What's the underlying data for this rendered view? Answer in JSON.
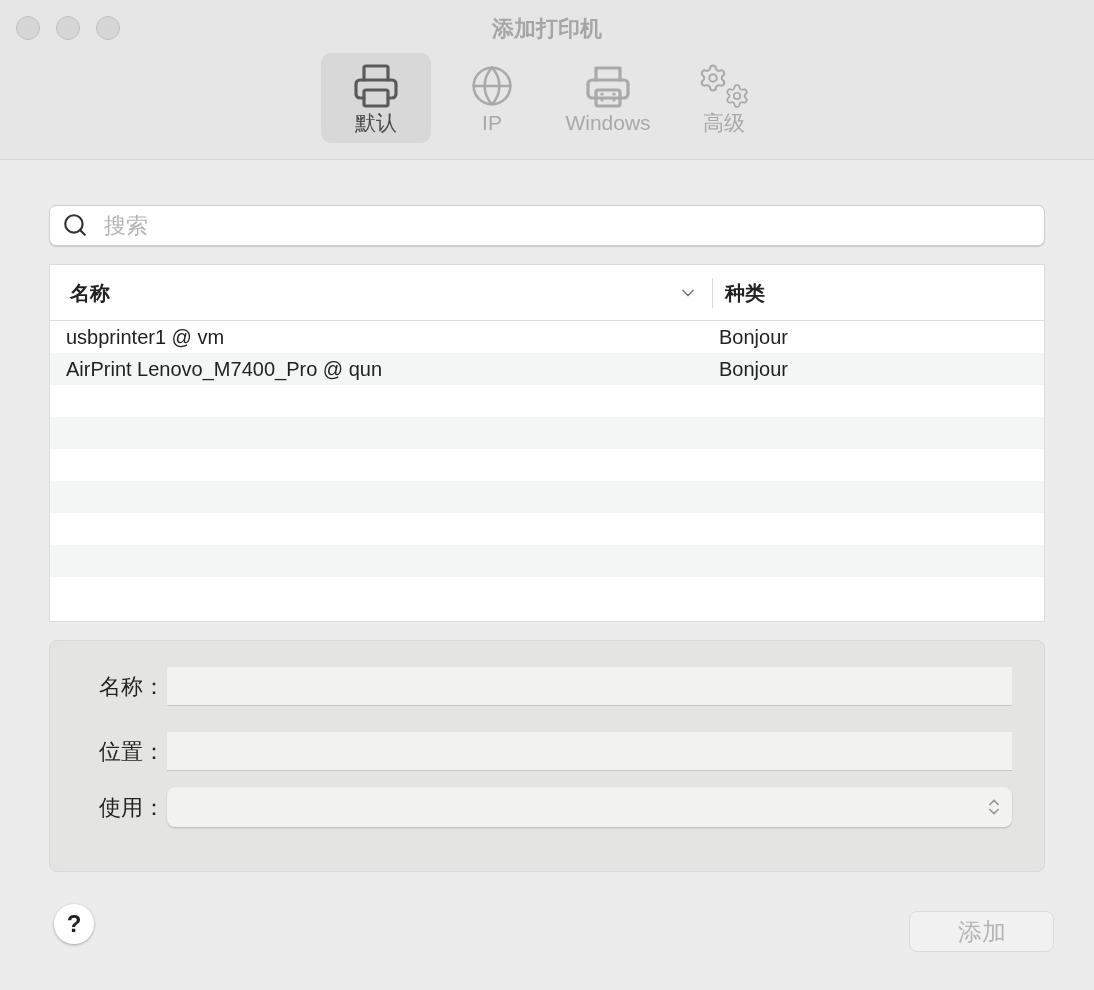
{
  "window": {
    "title": "添加打印机"
  },
  "tabs": [
    {
      "label": "默认",
      "kind": "printer",
      "selected": true
    },
    {
      "label": "IP",
      "kind": "globe",
      "selected": false
    },
    {
      "label": "Windows",
      "kind": "windows",
      "selected": false
    },
    {
      "label": "高级",
      "kind": "gears",
      "selected": false
    }
  ],
  "search": {
    "placeholder": "搜索"
  },
  "table": {
    "columns": [
      "名称",
      "种类"
    ],
    "rows": [
      [
        "usbprinter1 @ vm",
        "Bonjour"
      ],
      [
        "AirPrint Lenovo_M7400_Pro @ qun",
        "Bonjour"
      ]
    ]
  },
  "form": {
    "fields": [
      {
        "label": "名称：",
        "kind": "text"
      },
      {
        "label": "位置：",
        "kind": "text"
      },
      {
        "label": "使用：",
        "kind": "select"
      }
    ]
  },
  "help_button": {
    "label": "?"
  },
  "add_button": {
    "label": "添加",
    "disabled": true
  }
}
